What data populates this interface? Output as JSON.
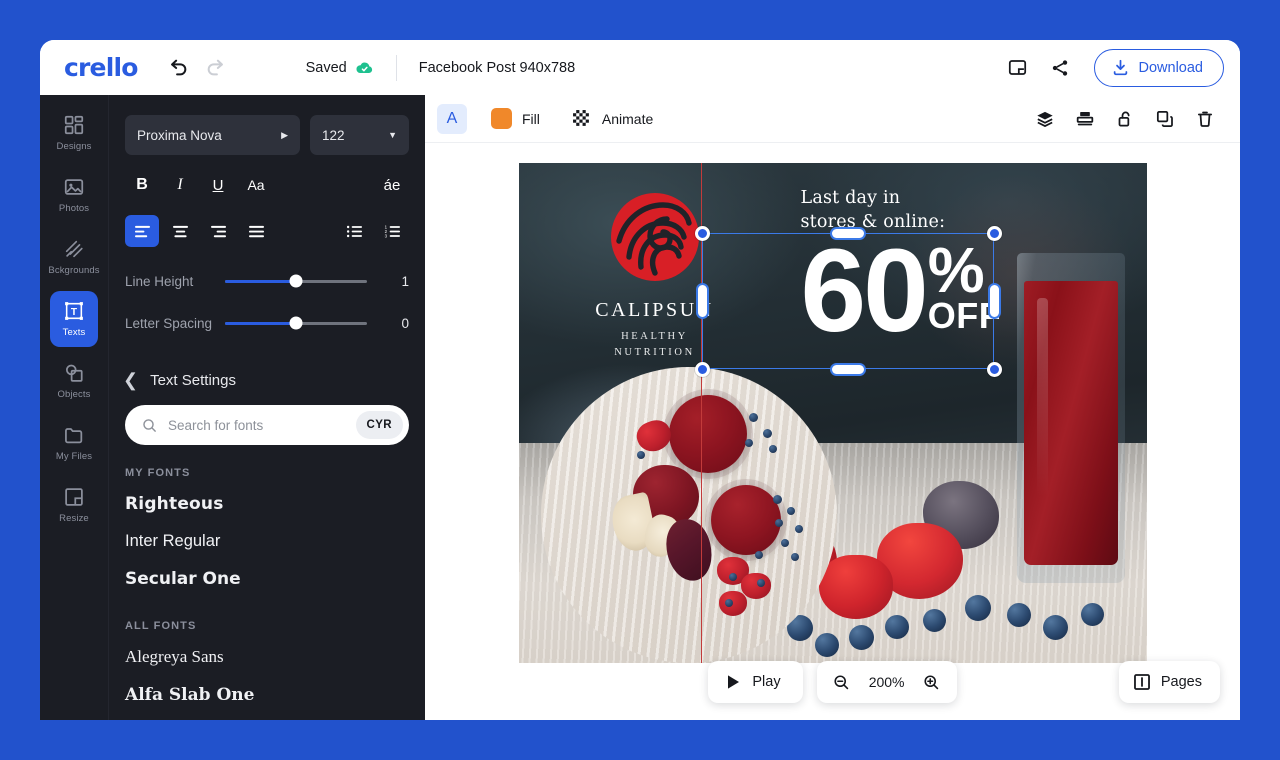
{
  "brandbar": {
    "logo_text": "crello",
    "undo_icon": "undo-icon",
    "redo_icon": "redo-icon",
    "saved_label": "Saved",
    "saved_icon": "cloud-check-icon",
    "document_title": "Facebook Post 940x788",
    "present_icon": "present-icon",
    "share_icon": "share-icon",
    "download_label": "Download",
    "download_icon": "download-icon",
    "accent_color": "#2a5ce0"
  },
  "rail": {
    "items": [
      {
        "label": "Designs",
        "icon": "grid-icon",
        "active": false
      },
      {
        "label": "Photos",
        "icon": "image-icon",
        "active": false
      },
      {
        "label": "Bckgrounds",
        "icon": "stripes-icon",
        "active": false
      },
      {
        "label": "Texts",
        "icon": "text-box-icon",
        "active": true
      },
      {
        "label": "Objects",
        "icon": "shapes-icon",
        "active": false
      },
      {
        "label": "My Files",
        "icon": "folder-icon",
        "active": false
      },
      {
        "label": "Resize",
        "icon": "resize-icon",
        "active": false
      }
    ]
  },
  "panel": {
    "font_family": "Proxima Nova",
    "font_size": "122",
    "format_buttons": [
      {
        "name": "bold",
        "glyph": "B"
      },
      {
        "name": "italic",
        "glyph": "I"
      },
      {
        "name": "underline",
        "glyph": "U"
      },
      {
        "name": "case",
        "glyph": "Aa"
      },
      {
        "name": "accent",
        "glyph": "áe"
      }
    ],
    "align_buttons": [
      {
        "name": "align-left",
        "active": true
      },
      {
        "name": "align-center",
        "active": false
      },
      {
        "name": "align-right",
        "active": false
      },
      {
        "name": "align-justify",
        "active": false
      }
    ],
    "list_buttons": [
      {
        "name": "bulleted-list"
      },
      {
        "name": "numbered-list"
      }
    ],
    "line_height": {
      "label": "Line Height",
      "value": "1"
    },
    "letter_spacing": {
      "label": "Letter Spacing",
      "value": "0"
    },
    "settings_title": "Text Settings",
    "back_icon": "chevron-left-icon",
    "search": {
      "placeholder": "Search for fonts",
      "value": "",
      "icon": "search-icon",
      "cyr_label": "CYR"
    },
    "my_fonts_header": "MY FONTS",
    "my_fonts": [
      "Righteous",
      "Inter Regular",
      "Secular One"
    ],
    "all_fonts_header": "ALL FONTS",
    "all_fonts": [
      "Alegreya Sans",
      "Alfa Slab One"
    ]
  },
  "context_bar": {
    "text_button": "A",
    "fill_label": "Fill",
    "fill_color": "#f0882a",
    "transparency_icon": "checkerboard-icon",
    "animate_label": "Animate",
    "animate_icon": "animate-icon",
    "tools": [
      {
        "name": "layers-icon"
      },
      {
        "name": "align-position-icon"
      },
      {
        "name": "unlock-icon"
      },
      {
        "name": "duplicate-icon"
      },
      {
        "name": "trash-icon"
      }
    ]
  },
  "canvas": {
    "brand_name": "CALIPSUN",
    "brand_sub_line1": "HEALTHY",
    "brand_sub_line2": "NUTRITION",
    "brand_mark": "rose-swirl-logo-icon",
    "headline_line1": "Last day in",
    "headline_line2": "stores & online:",
    "discount_number": "60",
    "discount_symbol": "%",
    "discount_off": "OFF",
    "selection_active": true
  },
  "bottom_bar": {
    "play_label": "Play",
    "play_icon": "play-icon",
    "zoom_out_icon": "zoom-out-icon",
    "zoom_in_icon": "zoom-in-icon",
    "zoom_value": "200%",
    "pages_label": "Pages",
    "pages_icon": "pages-icon"
  }
}
